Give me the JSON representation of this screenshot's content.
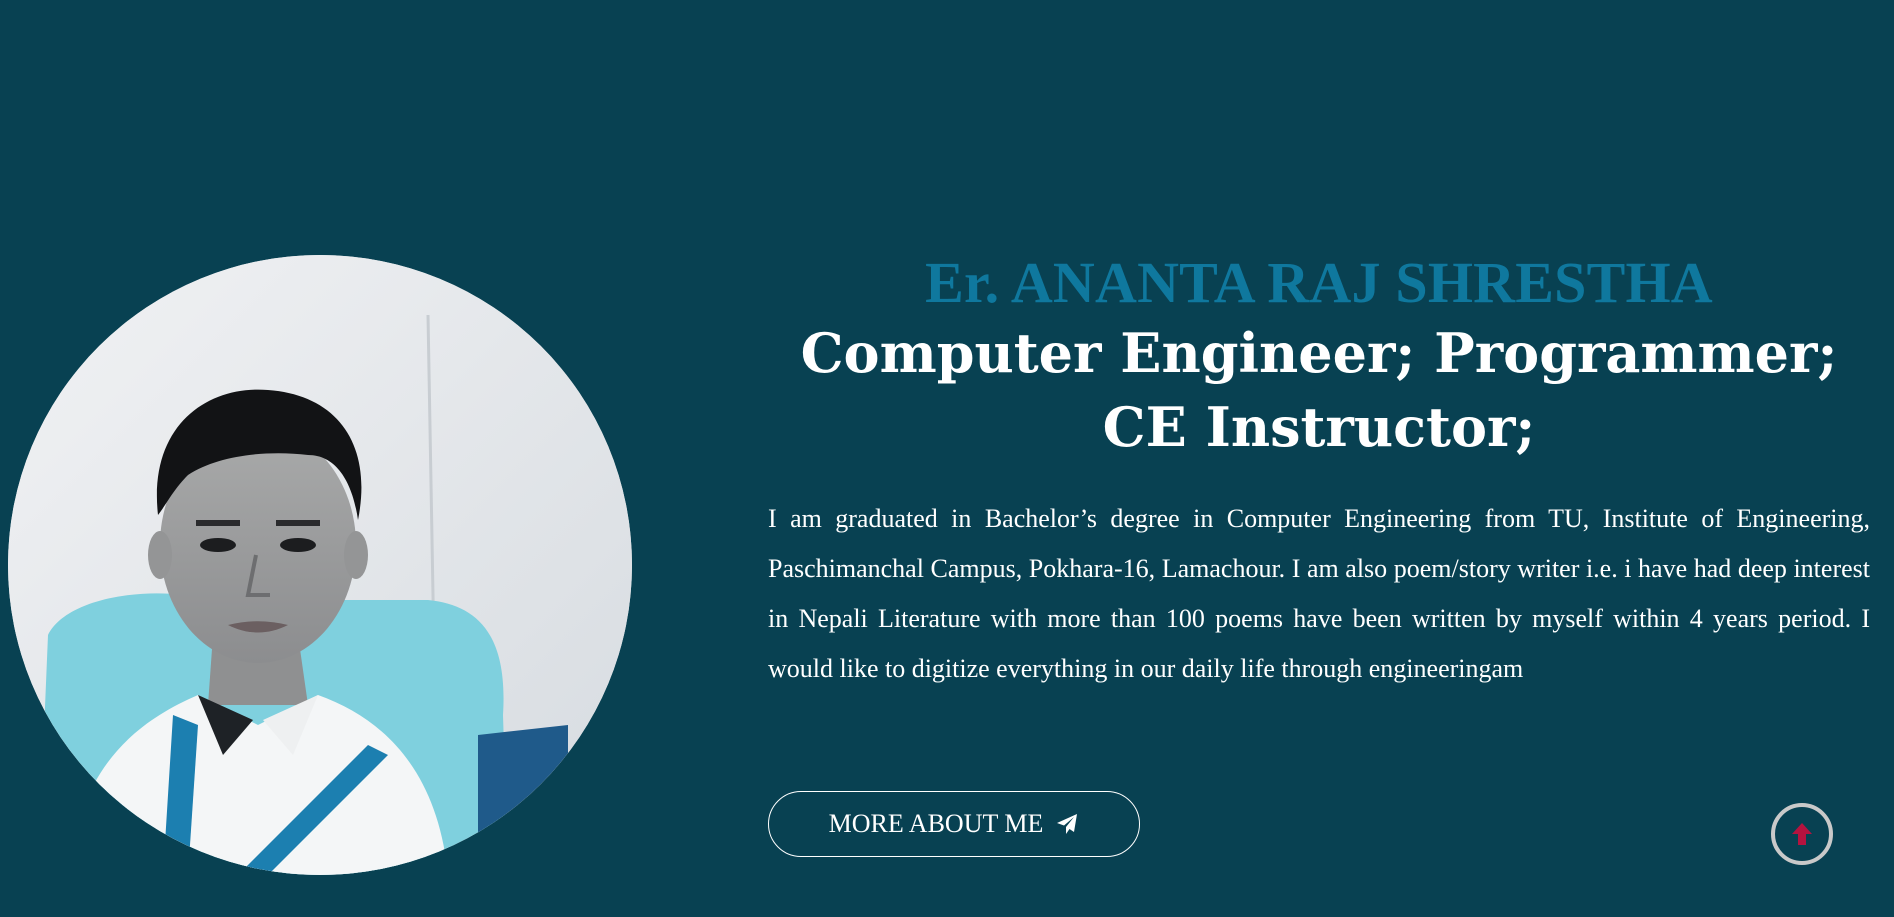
{
  "profile": {
    "name": "Er. ANANTA RAJ SHRESTHA",
    "roles": "Computer Engineer; Programmer; CE Instructor;",
    "bio": "I am graduated in Bachelor’s degree in Computer Engineering from TU, Institute of Engineering, Paschimanchal Campus, Pokhara-16, Lamachour. I am also poem/story writer i.e. i have had deep interest in Nepali Literature with more than 100 poems have been written by myself within 4 years period. I would like to digitize everything in our daily life through engineeringam",
    "photo_alt": "Profile photo"
  },
  "actions": {
    "more_about_label": "MORE ABOUT ME",
    "more_about_icon": "paper-plane-icon",
    "scroll_top_icon": "arrow-up-icon"
  },
  "colors": {
    "background": "#084152",
    "name_accent": "#0f789e",
    "text": "#ffffff",
    "scroll_arrow": "#b5133f",
    "scroll_ring": "#c9c9c9"
  }
}
